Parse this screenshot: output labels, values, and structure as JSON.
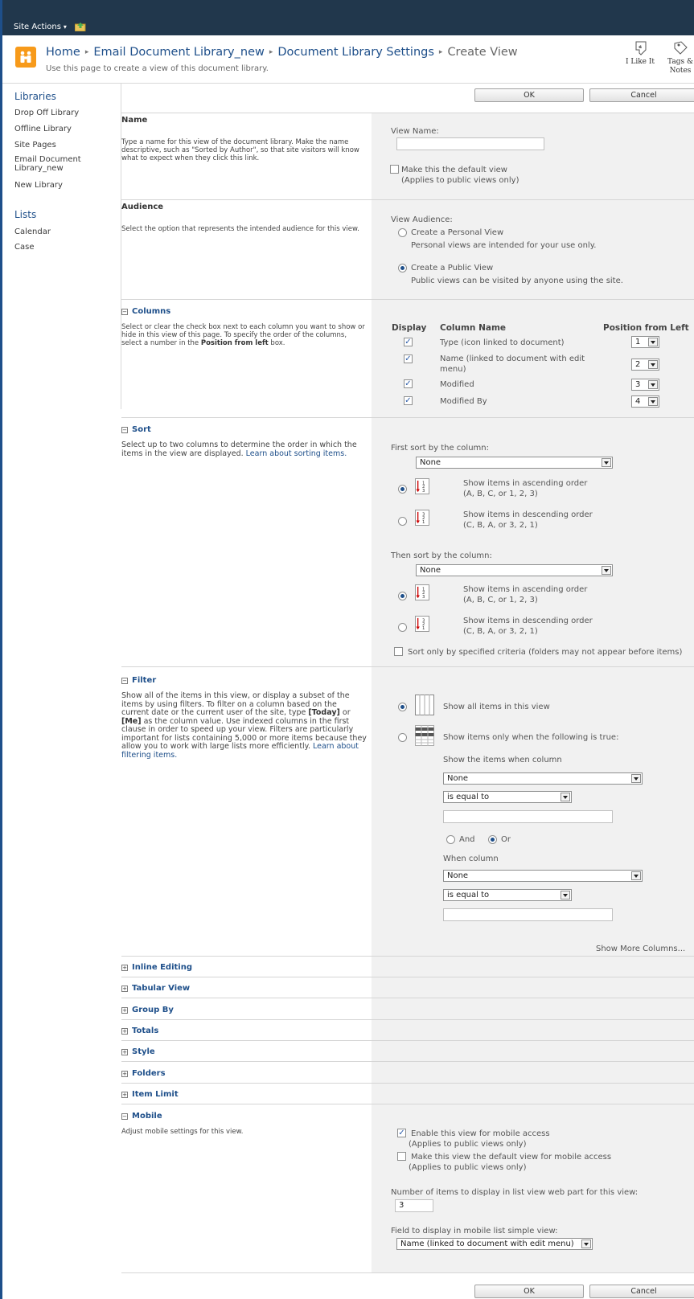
{
  "ribbon": {
    "site_actions": "Site Actions",
    "caret": "▾"
  },
  "breadcrumb": [
    "Home",
    "Email Document Library_new",
    "Document Library Settings",
    "Create View"
  ],
  "breadcrumb_sep": "▸",
  "page_description": "Use this page to create a view of this document library.",
  "social": {
    "like": "I Like It",
    "tags": "Tags &",
    "notes": "Notes"
  },
  "nav": {
    "libraries_heading": "Libraries",
    "libraries": [
      "Drop Off Library",
      "Offline Library",
      "Site Pages",
      "Email Document",
      "Library_new",
      "New Library"
    ],
    "lists_heading": "Lists",
    "lists": [
      "Calendar",
      "Case"
    ]
  },
  "buttons": {
    "ok": "OK",
    "cancel": "Cancel"
  },
  "name_section": {
    "title": "Name",
    "desc": "Type a name for this view of the document library. Make the name descriptive, such as \"Sorted by Author\", so that site visitors will know what to expect when they click this link.",
    "view_name_label": "View Name:",
    "view_name_value": "",
    "default_view_label": "Make this the default view",
    "default_view_note": "(Applies to public views only)",
    "default_view_checked": false
  },
  "audience_section": {
    "title": "Audience",
    "desc": "Select the option that represents the intended audience for this view.",
    "label": "View Audience:",
    "personal": "Create a Personal View",
    "personal_note": "Personal views are intended for your use only.",
    "public": "Create a Public View",
    "public_note": "Public views can be visited by anyone using the site.",
    "selected": "public"
  },
  "columns_section": {
    "title": "Columns",
    "desc_pre": "Select or clear the check box next to each column you want to show or hide in this view of this page. To specify the order of the columns, select a number in the ",
    "desc_bold": "Position from left",
    "desc_post": " box.",
    "headers": {
      "display": "Display",
      "name": "Column Name",
      "position": "Position from Left"
    },
    "rows": [
      {
        "name": "Type (icon linked to document)",
        "position": "1",
        "checked": true
      },
      {
        "name": "Name (linked to document with edit",
        "name2": "menu)",
        "position": "2",
        "checked": true
      },
      {
        "name": "Modified",
        "position": "3",
        "checked": true
      },
      {
        "name": "Modified By",
        "position": "4",
        "checked": true
      }
    ]
  },
  "sort_section": {
    "title": "Sort",
    "desc": "Select up to two columns to determine the order in which the items in the view are displayed.",
    "link": "Learn about sorting items.",
    "first_label": "First sort by the column:",
    "first_value": "None",
    "then_label": "Then sort by the column:",
    "then_value": "None",
    "asc": "Show items in ascending order",
    "asc_note": "(A, B, C, or 1, 2, 3)",
    "desc_order": "Show items in descending order",
    "desc_note": "(C, B, A, or 3, 2, 1)",
    "criteria_label": "Sort only by specified criteria (folders may not appear before items)",
    "first_selected": "ascending",
    "then_selected": "ascending"
  },
  "filter_section": {
    "title": "Filter",
    "desc_1": "Show all of the items in this view, or display a subset of the items by using filters. To filter on a column based on the current date or the current user of the site, type ",
    "today": "[Today]",
    "or_word": " or ",
    "me": "[Me]",
    "desc_2": " as the column value. Use indexed columns in the first clause in order to speed up your view. Filters are particularly important for lists containing 5,000 or more items because they allow you to work with large lists more efficiently. ",
    "link": "Learn about filtering items.",
    "show_all": "Show all items in this view",
    "show_when": "Show items only when the following is true:",
    "when_column_1": "Show the items when column",
    "column_1_value": "None",
    "operator_1": "is equal to",
    "and_label": "And",
    "or_label": "Or",
    "when_column_2": "When column",
    "column_2_value": "None",
    "operator_2": "is equal to",
    "more_columns": "Show More Columns...",
    "selected": "show_all",
    "logic_selected": "or"
  },
  "collapsed_sections": [
    "Inline Editing",
    "Tabular View",
    "Group By",
    "Totals",
    "Style",
    "Folders",
    "Item Limit"
  ],
  "mobile_section": {
    "title": "Mobile",
    "desc": "Adjust mobile settings for this view.",
    "enable": "Enable this view for mobile access",
    "enable_note": "(Applies to public views only)",
    "make_default": "Make this view the default view for mobile access",
    "make_default_note": "(Applies to public views only)",
    "items_label": "Number of items to display in list view web part for this view:",
    "items_value": "3",
    "field_label": "Field to display in mobile list simple view:",
    "field_value": "Name (linked to document with edit menu)",
    "enable_checked": true,
    "make_default_checked": false
  },
  "toggle_glyphs": {
    "expanded": "−",
    "collapsed": "+"
  },
  "colors": {
    "accent": "#1e4f8a",
    "ribbon": "#21374c",
    "panel": "#f1f1f1"
  }
}
